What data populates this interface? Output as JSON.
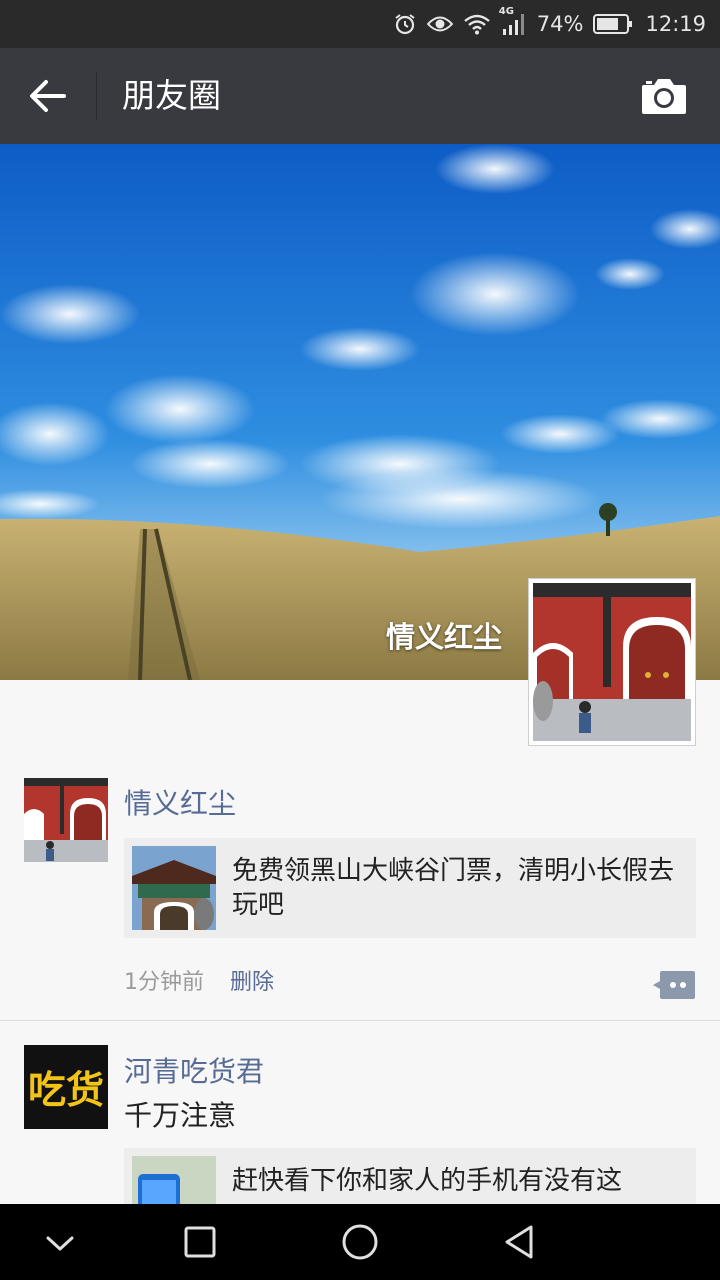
{
  "status_bar": {
    "network": "4G",
    "battery": "74%",
    "time": "12:19",
    "icons": [
      "alarm-icon",
      "eye-icon",
      "wifi-icon",
      "signal-icon",
      "battery-icon"
    ]
  },
  "header": {
    "title": "朋友圈",
    "back_icon": "back-arrow-icon",
    "camera_icon": "camera-icon",
    "bg_color": "#393a3f"
  },
  "profile": {
    "name": "情义红尘"
  },
  "posts": [
    {
      "author": "情义红尘",
      "text": "",
      "link_title": "免费领黑山大峡谷门票，清明小长假去玩吧",
      "time": "1分钟前",
      "delete_label": "删除"
    },
    {
      "author": "河青吃货君",
      "avatar_text": "吃货",
      "text": "千万注意",
      "link_title": "赶快看下你和家人的手机有没有这"
    }
  ],
  "colors": {
    "name_link": "#576b95",
    "status_bar": "#2a2a2b",
    "page_bg": "#f7f7f7"
  },
  "nav_icons": [
    "collapse-icon",
    "recents-icon",
    "home-icon",
    "back-icon"
  ]
}
